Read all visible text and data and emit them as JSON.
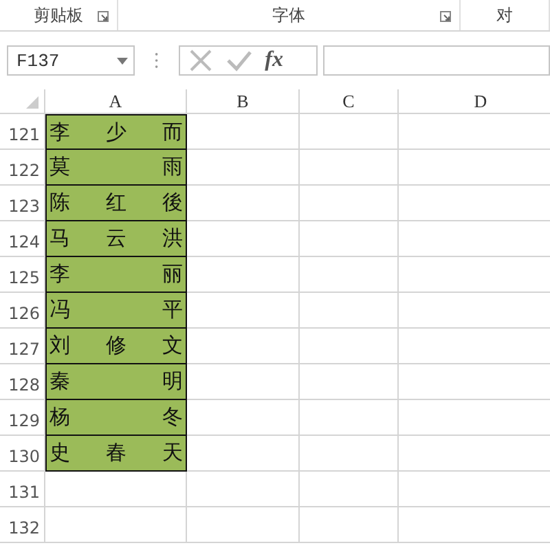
{
  "ribbon_groups": [
    {
      "label": "剪贴板",
      "launcher": true
    },
    {
      "label": "字体",
      "launcher": true
    },
    {
      "label": "对",
      "launcher": false
    }
  ],
  "formula_bar": {
    "name_box": "F137",
    "function_button": "fx"
  },
  "columns": [
    "A",
    "B",
    "C",
    "D"
  ],
  "rows": [
    {
      "number": "121",
      "cells": [
        "李少而"
      ]
    },
    {
      "number": "122",
      "cells": [
        "莫雨"
      ]
    },
    {
      "number": "123",
      "cells": [
        "陈红後"
      ]
    },
    {
      "number": "124",
      "cells": [
        "马云洪"
      ]
    },
    {
      "number": "125",
      "cells": [
        "李丽"
      ]
    },
    {
      "number": "126",
      "cells": [
        "冯平"
      ]
    },
    {
      "number": "127",
      "cells": [
        "刘修文"
      ]
    },
    {
      "number": "128",
      "cells": [
        "秦明"
      ]
    },
    {
      "number": "129",
      "cells": [
        "杨冬"
      ]
    },
    {
      "number": "130",
      "cells": [
        "史春天"
      ]
    },
    {
      "number": "131",
      "cells": []
    },
    {
      "number": "132",
      "cells": []
    }
  ]
}
